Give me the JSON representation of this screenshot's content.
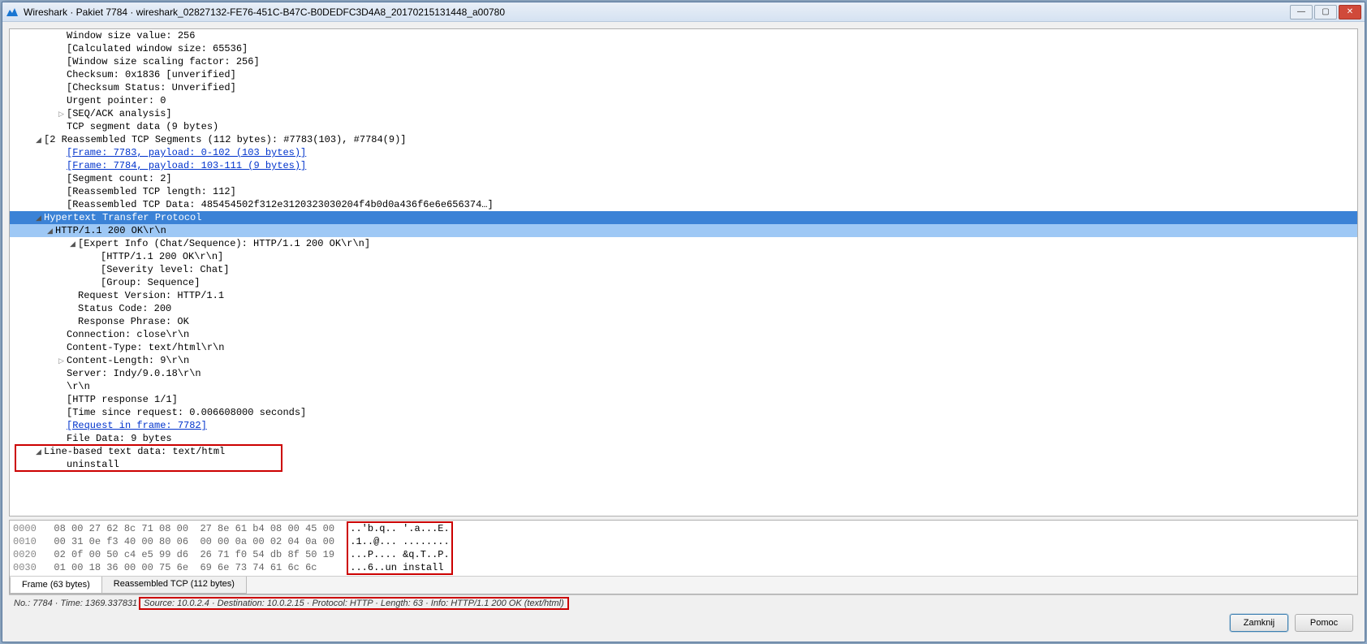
{
  "window": {
    "title": "Wireshark · Pakiet 7784 · wireshark_02827132-FE76-451C-B47C-B0DEDFC3D4A8_20170215131448_a00780"
  },
  "tree": [
    {
      "indent": 4,
      "arrow": "none",
      "txt": "Window size value: 256"
    },
    {
      "indent": 4,
      "arrow": "none",
      "txt": "[Calculated window size: 65536]"
    },
    {
      "indent": 4,
      "arrow": "none",
      "txt": "[Window size scaling factor: 256]"
    },
    {
      "indent": 4,
      "arrow": "none",
      "txt": "Checksum: 0x1836 [unverified]"
    },
    {
      "indent": 4,
      "arrow": "none",
      "txt": "[Checksum Status: Unverified]"
    },
    {
      "indent": 4,
      "arrow": "none",
      "txt": "Urgent pointer: 0"
    },
    {
      "indent": 4,
      "arrow": "closed",
      "txt": "[SEQ/ACK analysis]"
    },
    {
      "indent": 4,
      "arrow": "none",
      "txt": "TCP segment data (9 bytes)"
    },
    {
      "indent": 2,
      "arrow": "open",
      "txt": "[2 Reassembled TCP Segments (112 bytes): #7783(103), #7784(9)]"
    },
    {
      "indent": 4,
      "arrow": "none",
      "link": true,
      "txt": "[Frame: 7783, payload: 0-102 (103 bytes)]"
    },
    {
      "indent": 4,
      "arrow": "none",
      "link": true,
      "txt": "[Frame: 7784, payload: 103-111 (9 bytes)]"
    },
    {
      "indent": 4,
      "arrow": "none",
      "txt": "[Segment count: 2]"
    },
    {
      "indent": 4,
      "arrow": "none",
      "txt": "[Reassembled TCP length: 112]"
    },
    {
      "indent": 4,
      "arrow": "none",
      "txt": "[Reassembled TCP Data: 485454502f312e3120323030204f4b0d0a436f6e6e656374…]"
    },
    {
      "indent": 2,
      "arrow": "open",
      "cls": "sel-primary",
      "txt": "Hypertext Transfer Protocol"
    },
    {
      "indent": 3,
      "arrow": "open",
      "cls": "sel-secondary",
      "txt": "HTTP/1.1 200 OK\\r\\n"
    },
    {
      "indent": 5,
      "arrow": "open",
      "txt": "[Expert Info (Chat/Sequence): HTTP/1.1 200 OK\\r\\n]"
    },
    {
      "indent": 7,
      "arrow": "none",
      "txt": "[HTTP/1.1 200 OK\\r\\n]"
    },
    {
      "indent": 7,
      "arrow": "none",
      "txt": "[Severity level: Chat]"
    },
    {
      "indent": 7,
      "arrow": "none",
      "txt": "[Group: Sequence]"
    },
    {
      "indent": 5,
      "arrow": "none",
      "txt": "Request Version: HTTP/1.1"
    },
    {
      "indent": 5,
      "arrow": "none",
      "txt": "Status Code: 200"
    },
    {
      "indent": 5,
      "arrow": "none",
      "txt": "Response Phrase: OK"
    },
    {
      "indent": 4,
      "arrow": "none",
      "txt": "Connection: close\\r\\n"
    },
    {
      "indent": 4,
      "arrow": "none",
      "txt": "Content-Type: text/html\\r\\n"
    },
    {
      "indent": 4,
      "arrow": "closed",
      "txt": "Content-Length: 9\\r\\n"
    },
    {
      "indent": 4,
      "arrow": "none",
      "txt": "Server: Indy/9.0.18\\r\\n"
    },
    {
      "indent": 4,
      "arrow": "none",
      "txt": "\\r\\n"
    },
    {
      "indent": 4,
      "arrow": "none",
      "txt": "[HTTP response 1/1]"
    },
    {
      "indent": 4,
      "arrow": "none",
      "txt": "[Time since request: 0.006608000 seconds]"
    },
    {
      "indent": 4,
      "arrow": "none",
      "link": true,
      "txt": "[Request in frame: 7782]"
    },
    {
      "indent": 4,
      "arrow": "none",
      "txt": "File Data: 9 bytes"
    },
    {
      "indent": 2,
      "arrow": "open",
      "txt": "Line-based text data: text/html"
    },
    {
      "indent": 4,
      "arrow": "none",
      "txt": "uninstall"
    }
  ],
  "hex": {
    "rows": [
      {
        "offset": "0000",
        "bytes": "08 00 27 62 8c 71 08 00  27 8e 61 b4 08 00 45 00",
        "ascii": "..'b.q.. '.a...E."
      },
      {
        "offset": "0010",
        "bytes": "00 31 0e f3 40 00 80 06  00 00 0a 00 02 04 0a 00",
        "ascii": ".1..@... ........"
      },
      {
        "offset": "0020",
        "bytes": "02 0f 00 50 c4 e5 99 d6  26 71 f0 54 db 8f 50 19",
        "ascii": "...P.... &q.T..P."
      },
      {
        "offset": "0030",
        "bytes": "01 00 18 36 00 00 75 6e  69 6e 73 74 61 6c 6c",
        "ascii": "...6..un install"
      }
    ]
  },
  "tabs": {
    "frame": "Frame (63 bytes)",
    "reasm": "Reassembled TCP (112 bytes)"
  },
  "status": {
    "left": "No.: 7784 · Time: 1369.337831",
    "boxed": "Source: 10.0.2.4 · Destination: 10.0.2.15 · Protocol: HTTP · Length: 63 · Info: HTTP/1.1 200 OK (text/html)"
  },
  "buttons": {
    "close": "Zamknij",
    "help": "Pomoc"
  }
}
